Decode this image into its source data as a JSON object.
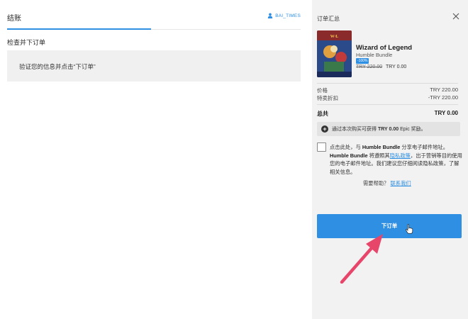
{
  "checkout": {
    "tab_title": "结账",
    "username": "BAI_TIMES",
    "section_title": "检查并下订单",
    "verify_message": "验证您的信息并点击“下订单”"
  },
  "summary": {
    "title": "订单汇总",
    "product": {
      "name": "Wizard of Legend",
      "publisher": "Humble Bundle",
      "discount_badge": "-100%",
      "original_price": "TRY 220.00",
      "final_price": "TRY 0.00"
    },
    "price_label": "价格",
    "price_value": "TRY 220.00",
    "discount_label": "特卖折扣",
    "discount_value": "-TRY 220.00",
    "total_label": "总共",
    "total_value": "TRY 0.00",
    "reward_prefix": "通过本次购买可获得",
    "reward_amount": "TRY 0.00",
    "reward_suffix": "Epic 奖励。",
    "consent_p1": "点击此处，与",
    "consent_brand1": "Humble Bundle",
    "consent_p2": "分享电子邮件地址。",
    "consent_brand2": "Humble Bundle",
    "consent_p3": "将遵照其",
    "consent_link": "隐私政策",
    "consent_p4": "，出于营销等目的使用您的电子邮件地址。我们建议您仔细阅读隐私政策，了解相关信息。",
    "help_text": "需要帮助？",
    "help_link": "联系我们",
    "order_button": "下订单"
  },
  "colors": {
    "accent": "#2f8fe3",
    "annotation_arrow": "#e8456b"
  },
  "icons": [
    "user-icon",
    "close-icon",
    "plus-circle-icon",
    "hand-cursor-icon"
  ]
}
